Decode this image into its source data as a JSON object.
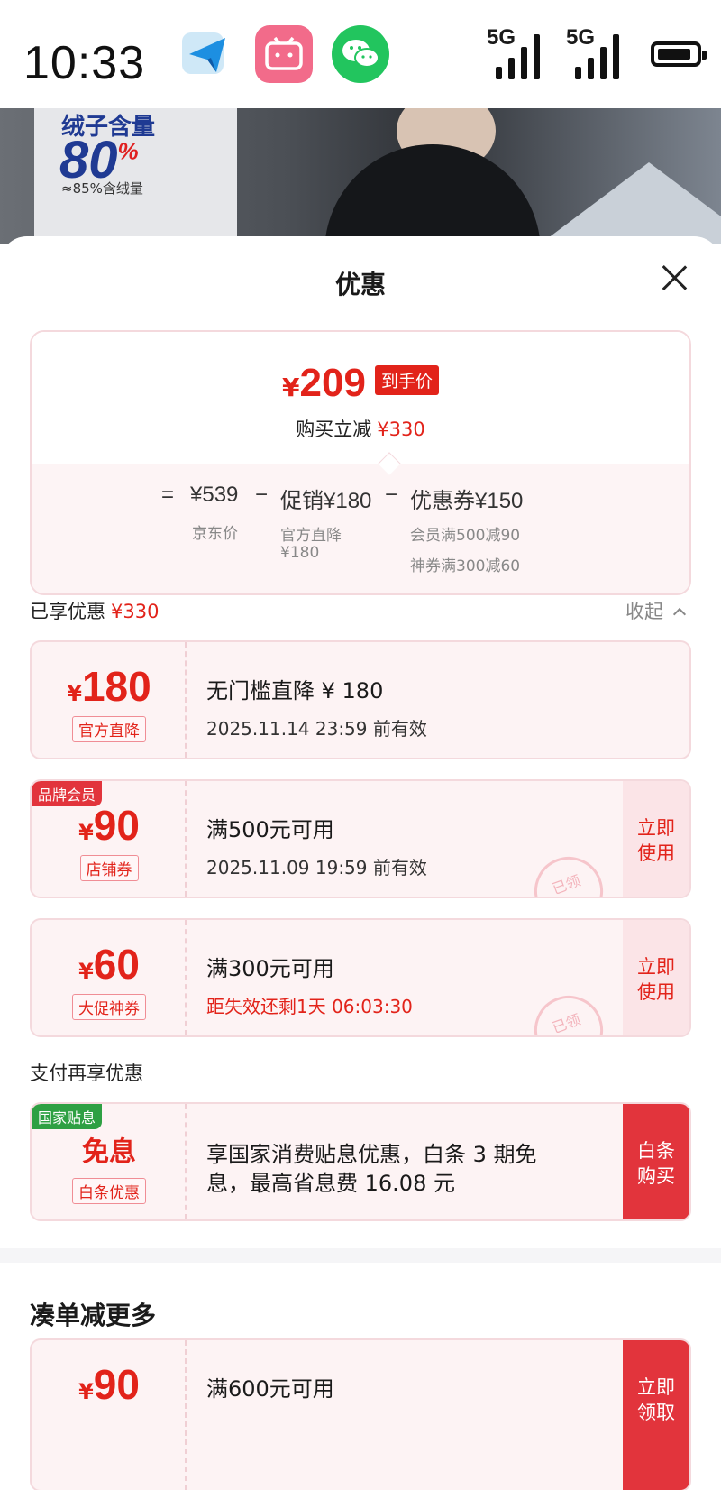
{
  "status_bar": {
    "time": "10:33",
    "signal1": "5G",
    "signal2": "5G",
    "apps": [
      "telegram-icon",
      "bilibili-icon",
      "wechat-icon"
    ]
  },
  "hero": {
    "line1": "绒子含量",
    "percent": "80",
    "percent_sign": "%",
    "line3": "≈85%含绒量"
  },
  "sheet": {
    "title": "优惠"
  },
  "summary": {
    "yen": "¥",
    "final_price": "209",
    "final_tag": "到手价",
    "reduce_label": "购买立减",
    "reduce_amount": "¥330",
    "formula": {
      "equals": "=",
      "base": "¥539",
      "minus1": "−",
      "promo": "促销¥180",
      "minus2": "−",
      "coupon": "优惠券¥150"
    },
    "labels": {
      "base": "京东价",
      "promo_1": "官方直降",
      "promo_2": "¥180",
      "coupon_1": "会员满500减90",
      "coupon_2": "神券满300减60"
    }
  },
  "enjoyed": {
    "label": "已享优惠",
    "amount": "¥330",
    "collapse": "收起"
  },
  "coupons": [
    {
      "yen": "¥",
      "value": "180",
      "tag": "官方直降",
      "title": "无门槛直降 ¥ 180",
      "detail": "2025.11.14 23:59 前有效"
    },
    {
      "badge": "品牌会员",
      "yen": "¥",
      "value": "90",
      "tag": "店铺券",
      "title": "满500元可用",
      "detail": "2025.11.09 19:59 前有效",
      "action": "立即使用",
      "stamp": "已领"
    },
    {
      "yen": "¥",
      "value": "60",
      "tag": "大促神券",
      "title": "满300元可用",
      "detail": "距失效还剩1天 06:03:30",
      "action": "立即使用",
      "stamp": "已领"
    }
  ],
  "pay_section": {
    "label": "支付再享优惠",
    "card": {
      "badge": "国家贴息",
      "word": "免息",
      "tag": "白条优惠",
      "line1": "享国家消费贴息优惠，白条 3 期免",
      "line2": "息，最高省息费 16.08 元",
      "action": "白条购买"
    }
  },
  "more_section": {
    "label": "凑单减更多",
    "card": {
      "yen": "¥",
      "value": "90",
      "title": "满600元可用",
      "action": "立即领取"
    }
  },
  "colors": {
    "accent": "#e2231a",
    "card_bg": "#fdf3f4",
    "card_border": "#f4d9dd",
    "green_badge": "#2ea043"
  }
}
